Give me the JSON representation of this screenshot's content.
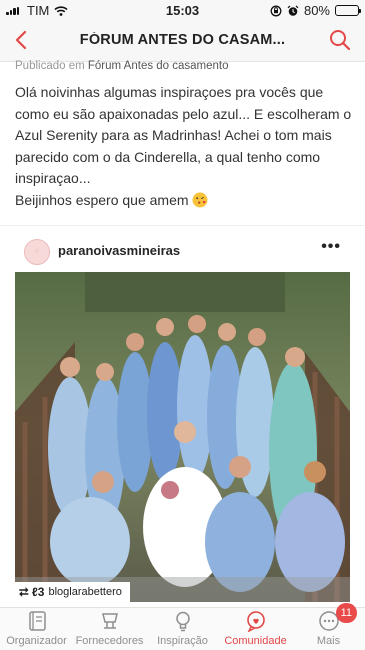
{
  "status_bar": {
    "carrier": "TIM",
    "time": "15:03",
    "battery": "80%",
    "battery_level": 0.8
  },
  "header": {
    "title": "FÓRUM ANTES DO CASAM...",
    "back_icon": "chevron-left-icon",
    "search_icon": "search-icon"
  },
  "post": {
    "published_prefix": "Publicado em",
    "forum_name": "Fórum Antes do casamento",
    "paragraphs": [
      "Olá noivinhas algumas inspiraçoes pra vocês que como eu são apaixonadas pelo azul... E escolheram o Azul Serenity para as Madrinhas! Achei o tom mais parecido com o da Cinderella, a qual tenho como inspiraçao...",
      "Beijinhos espero que amem"
    ],
    "emoji": "kiss-face-emoji"
  },
  "instagram": {
    "username": "paranoivasmineiras",
    "more_icon": "more-dots-icon",
    "photo_alt": "bridesmaids-blue-dresses-photo",
    "credit": "bloglarabettero"
  },
  "tab_bar": {
    "tabs": [
      {
        "label": "Organizador",
        "icon": "notebook-icon",
        "active": false
      },
      {
        "label": "Fornecedores",
        "icon": "vendors-icon",
        "active": false
      },
      {
        "label": "Inspiração",
        "icon": "lightbulb-icon",
        "active": false
      },
      {
        "label": "Comunidade",
        "icon": "community-chat-icon",
        "active": true
      },
      {
        "label": "Mais",
        "icon": "more-icon",
        "active": false,
        "badge": "11"
      }
    ],
    "active_color": "#e24848",
    "inactive_color": "#8e8e8e"
  },
  "colors": {
    "accent": "#e24848",
    "badge": "#e94a4a"
  }
}
